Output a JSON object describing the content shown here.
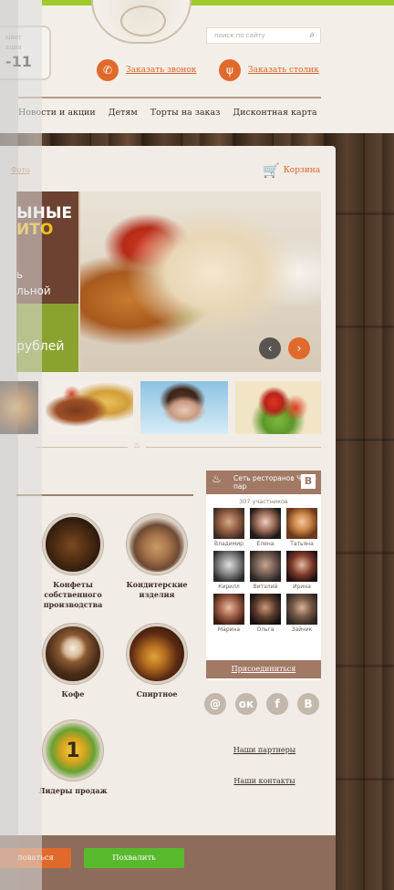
{
  "header": {
    "phone_caption_1": "ывет",
    "phone_caption_2": "ация",
    "phone_number": "-11",
    "search_placeholder": "поиск по сайту",
    "search_icon": "search-icon",
    "call_label": "Заказать звонок",
    "table_label": "Заказать столик"
  },
  "nav": {
    "items": [
      "Новости и акции",
      "Детям",
      "Торты на заказ",
      "Дисконтная карта"
    ]
  },
  "breadcrumbs": {
    "current": "Фото"
  },
  "cart": {
    "label": "Корзина"
  },
  "banner": {
    "line1": "ЫНЫЕ",
    "line2": "ИТО",
    "line3": "ь",
    "line4": "льной",
    "price": "рублей",
    "prev_icon": "‹",
    "next_icon": "›"
  },
  "categories": [
    {
      "label": "Конфеты собственного производства"
    },
    {
      "label": "Кондитерские изделия"
    },
    {
      "label": "Кофе"
    },
    {
      "label": "Спиртное"
    },
    {
      "label": "Лидеры продаж"
    }
  ],
  "vk": {
    "title": "Сеть ресторанов Чудо-пар",
    "vk_badge": "B",
    "members": "307 участников",
    "people": [
      "Владимир",
      "Елена",
      "Татьяна",
      "Кирилл",
      "Виталий",
      "Ирина",
      "Марина",
      "Ольга",
      "Зайчик"
    ],
    "join_label": "Присоединиться"
  },
  "social": [
    "@",
    "ок",
    "f",
    "B"
  ],
  "links": {
    "partners": "Наши партнеры",
    "contacts": "Наши контакты"
  },
  "footer": {
    "complain": "ловаться",
    "praise": "Похвалить"
  },
  "colors": {
    "accent": "#e06a2c",
    "green": "#59b92d",
    "brown": "#a17965",
    "top_bar": "#9ccb2b"
  }
}
